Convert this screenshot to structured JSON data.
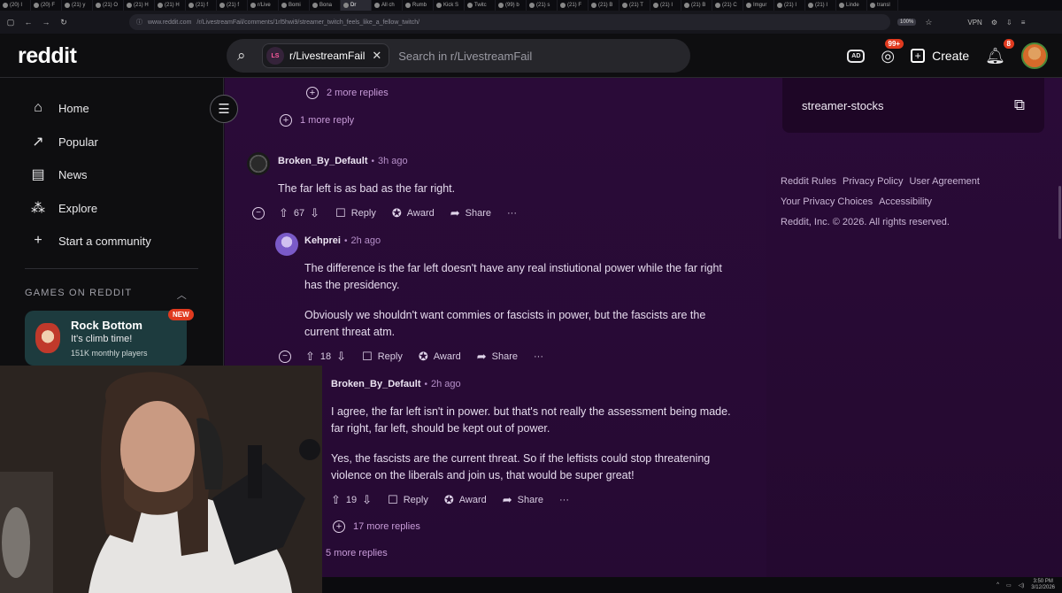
{
  "browser": {
    "tabs": [
      "(20) I",
      "(20) F",
      "(21) y",
      "(21) O",
      "(21) H",
      "(21) H",
      "(21) f",
      "(21) f",
      "r/Live",
      "Bomi",
      "Bona",
      "Dr",
      "All ch",
      "Rumb",
      "Kick S",
      "Twitc",
      "(99) b",
      "(21) s",
      "(21) F",
      "(21) B",
      "(21) T",
      "(21) I",
      "(21) B",
      "(21) C",
      "Imgur",
      "(21) I",
      "(21) I",
      "Linde",
      "transl"
    ],
    "active_tab_index": 11,
    "url_host": "www.reddit.com",
    "url_path": "/r/LivestreamFail/comments/1rl5hwi9/streamer_twitch_feels_like_a_fellow_twitch/",
    "zoom": "100%",
    "vpn_label": "VPN"
  },
  "header": {
    "logo": "reddit",
    "subreddit_chip_icon": "LS",
    "subreddit_chip": "r/LivestreamFail",
    "search_placeholder": "Search in r/LivestreamFail",
    "chat_badge": "99+",
    "notif_badge": "8",
    "create_label": "Create"
  },
  "sidebar": {
    "items": [
      {
        "label": "Home",
        "icon": "home-icon"
      },
      {
        "label": "Popular",
        "icon": "popular-icon"
      },
      {
        "label": "News",
        "icon": "news-icon"
      },
      {
        "label": "Explore",
        "icon": "explore-icon"
      },
      {
        "label": "Start a community",
        "icon": "plus-icon"
      }
    ],
    "games_heading": "GAMES ON REDDIT",
    "game": {
      "title": "Rock Bottom",
      "subtitle": "It's climb time!",
      "players": "151K monthly players",
      "badge": "NEW"
    }
  },
  "thread": {
    "more_replies_top": "2 more replies",
    "more_replies_2": "1 more reply",
    "comment1": {
      "author": "Broken_By_Default",
      "time": "3h ago",
      "text": "The far left is as bad as the far right.",
      "votes": "67",
      "reply": "Reply",
      "award": "Award",
      "share": "Share",
      "more": "···"
    },
    "comment2": {
      "author": "Kehprei",
      "time": "2h ago",
      "p1_line1": "The difference is the far left doesn't have any real instiutional power while the far right",
      "p1_line2": "has the presidency.",
      "p2_line1": "Obviously we shouldn't want commies or fascists in power, but the fascists are the",
      "p2_line2": "current threat atm.",
      "votes": "18",
      "reply": "Reply",
      "award": "Award",
      "share": "Share",
      "more": "···"
    },
    "comment3": {
      "author": "Broken_By_Default",
      "time": "2h ago",
      "p1_line1": "I agree, the far left isn't in power. but that's not really the assessment being made.",
      "p1_line2": "far right, far left, should be kept out of power.",
      "p2_line1": "Yes, the fascists are the current threat. So if the leftists could stop threatening",
      "p2_line2": "violence on the liberals and join us, that would be super great!",
      "votes": "19",
      "reply": "Reply",
      "award": "Award",
      "share": "Share",
      "more": "···"
    },
    "more_replies_17": "17 more replies",
    "more_replies_5": "5 more replies"
  },
  "right": {
    "community": "streamer-stocks",
    "links_row1": [
      "Reddit Rules",
      "Privacy Policy",
      "User Agreement"
    ],
    "links_row2": [
      "Your Privacy Choices",
      "Accessibility"
    ],
    "copyright": "Reddit, Inc. © 2026. All rights reserved."
  },
  "taskbar": {
    "time": "3:50 PM",
    "date": "3/12/2026"
  },
  "colors": {
    "thread_bg": "#2a0b38",
    "link_purple": "#c79bd8",
    "badge_red": "#e03a1f",
    "game_card": "#1d3b3e"
  }
}
